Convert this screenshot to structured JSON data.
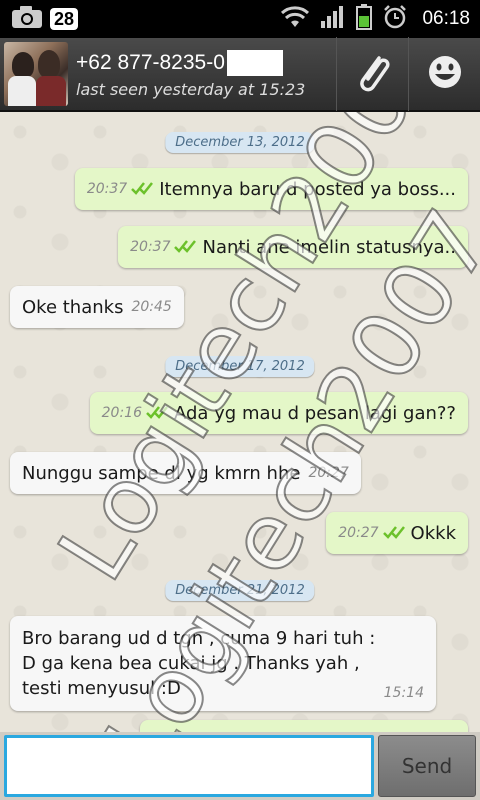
{
  "statusbar": {
    "notification_count": "28",
    "time": "06:18"
  },
  "header": {
    "contact_name": "+62 877-8235-0",
    "last_seen": "last seen yesterday at 15:23"
  },
  "dates": [
    "December 13, 2012",
    "December 17, 2012",
    "December 21, 2012"
  ],
  "messages": [
    {
      "dir": "out",
      "time": "20:37",
      "text": "Itemnya baru d posted ya boss..."
    },
    {
      "dir": "out",
      "time": "20:37",
      "text": "Nanti ane imelin statusnya.."
    },
    {
      "dir": "in",
      "time": "20:45",
      "text": "Oke thanks"
    },
    {
      "dir": "out",
      "time": "20:16",
      "text": "Ada yg mau d pesan lagi gan??"
    },
    {
      "dir": "in",
      "time": "20:27",
      "text": "Nunggu sampe dl yg kmrn hhe"
    },
    {
      "dir": "out",
      "time": "20:27",
      "text": "Okkk"
    },
    {
      "dir": "in",
      "time": "15:14",
      "lines": [
        "Bro barang ud d tgn , cuma 9 hari tuh :",
        "D ga kena bea cukai jg . Thanks yah ,",
        "testi menyusul :D"
      ]
    }
  ],
  "watermark_text": "Logitech2007",
  "input": {
    "placeholder": "",
    "send_label": "Send"
  },
  "colors": {
    "outgoing_bubble": "#e4f7c8",
    "incoming_bubble": "#f7f7f7",
    "date_pill": "#d7e6f2",
    "input_focus": "#2aa8e0"
  }
}
